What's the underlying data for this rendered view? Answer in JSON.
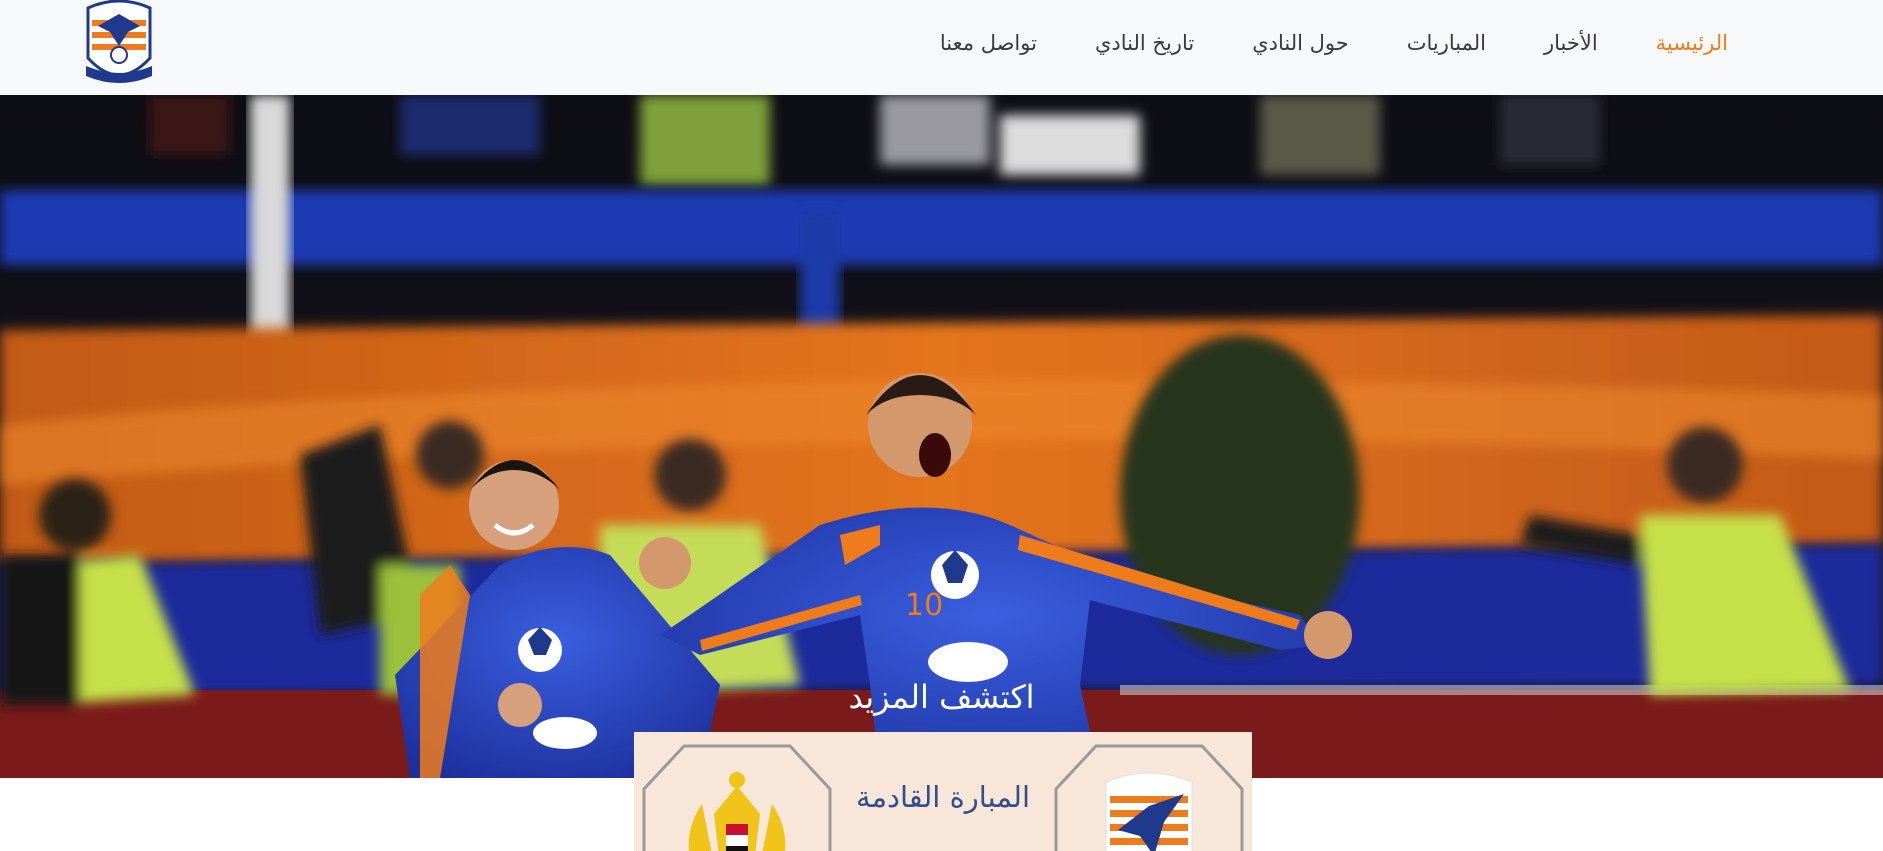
{
  "nav": {
    "items": [
      {
        "label": "الرئيسية",
        "active": true
      },
      {
        "label": "الأخبار",
        "active": false
      },
      {
        "label": "المباريات",
        "active": false
      },
      {
        "label": "حول النادي",
        "active": false
      },
      {
        "label": "تاريخ النادي",
        "active": false
      },
      {
        "label": "تواصل معنا",
        "active": false
      }
    ]
  },
  "hero": {
    "cta_label": "اكتشف المزيد",
    "image": "football players celebrating a goal"
  },
  "next_match": {
    "title": "المبارة القادمة",
    "home_logo": "club-eagle-crest-icon",
    "away_logo": "opponent-crest-icon"
  },
  "colors": {
    "accent": "#ee7c1c",
    "nav_text": "#3a3a3a",
    "card_bg": "#f8e6d9",
    "card_title": "#2e4f8c"
  }
}
